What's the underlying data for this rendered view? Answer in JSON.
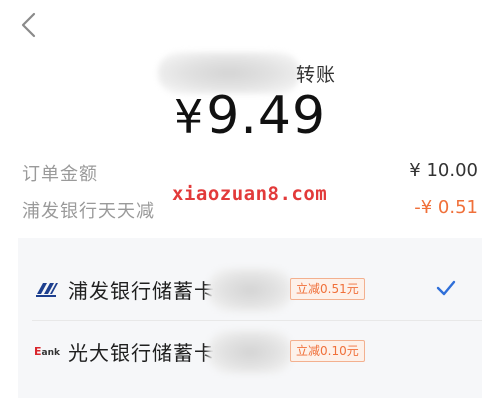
{
  "header": {
    "title_suffix": "转账",
    "amount_currency": "¥",
    "amount_value": "9.49"
  },
  "summary": {
    "order_label": "订单金额",
    "order_value": "¥ 10.00",
    "discount_label": "浦发银行天天减",
    "discount_value": "-¥ 0.51"
  },
  "watermark": "xiaozuan8.com",
  "cards": [
    {
      "name": "浦发银行储蓄卡",
      "promo": "立减0.51元",
      "selected": true,
      "logo": "spdb-logo-icon"
    },
    {
      "name": "光大银行储蓄卡",
      "promo": "立减0.10元",
      "selected": false,
      "logo": "ceb-logo-icon"
    }
  ],
  "colors": {
    "accent_blue": "#2f6fd9",
    "discount_orange": "#f0703a",
    "watermark_red": "#e23a3a"
  }
}
